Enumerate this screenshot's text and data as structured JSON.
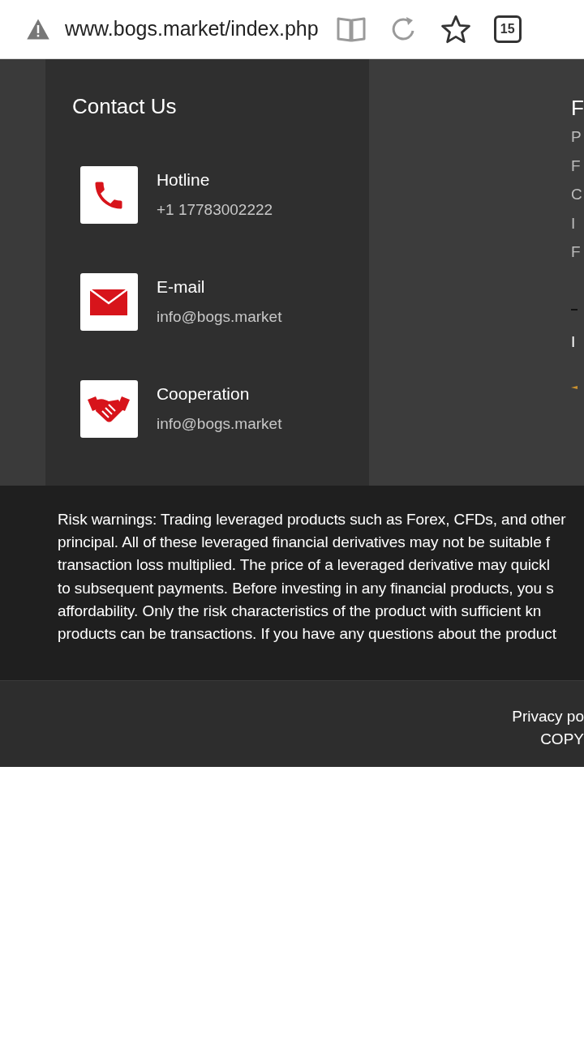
{
  "address_bar": {
    "url": "www.bogs.market/index.php",
    "tab_count": "15"
  },
  "contact": {
    "title": "Contact Us",
    "items": [
      {
        "kind": "phone",
        "label": "Hotline",
        "value": "+1 17783002222"
      },
      {
        "kind": "mail",
        "label": "E-mail",
        "value": "info@bogs.market"
      },
      {
        "kind": "handshake",
        "label": "Cooperation",
        "value": "info@bogs.market"
      }
    ]
  },
  "column_2": {
    "heading": "F",
    "links": [
      "P",
      "F",
      "C",
      "I",
      "F"
    ],
    "text_2": "I"
  },
  "risk_warning": [
    "Risk warnings: Trading leveraged products such as Forex, CFDs, and other",
    "principal. All of these leveraged financial derivatives may not be suitable f",
    "transaction loss multiplied. The price of a leveraged derivative may quickl",
    "to subsequent payments. Before investing in any financial products, you s",
    "affordability. Only the risk characteristics of the product with sufficient kn",
    "products can be transactions. If you have any questions about the product"
  ],
  "footer": {
    "privacy_link": "Privacy po",
    "copyright": "COPY"
  }
}
